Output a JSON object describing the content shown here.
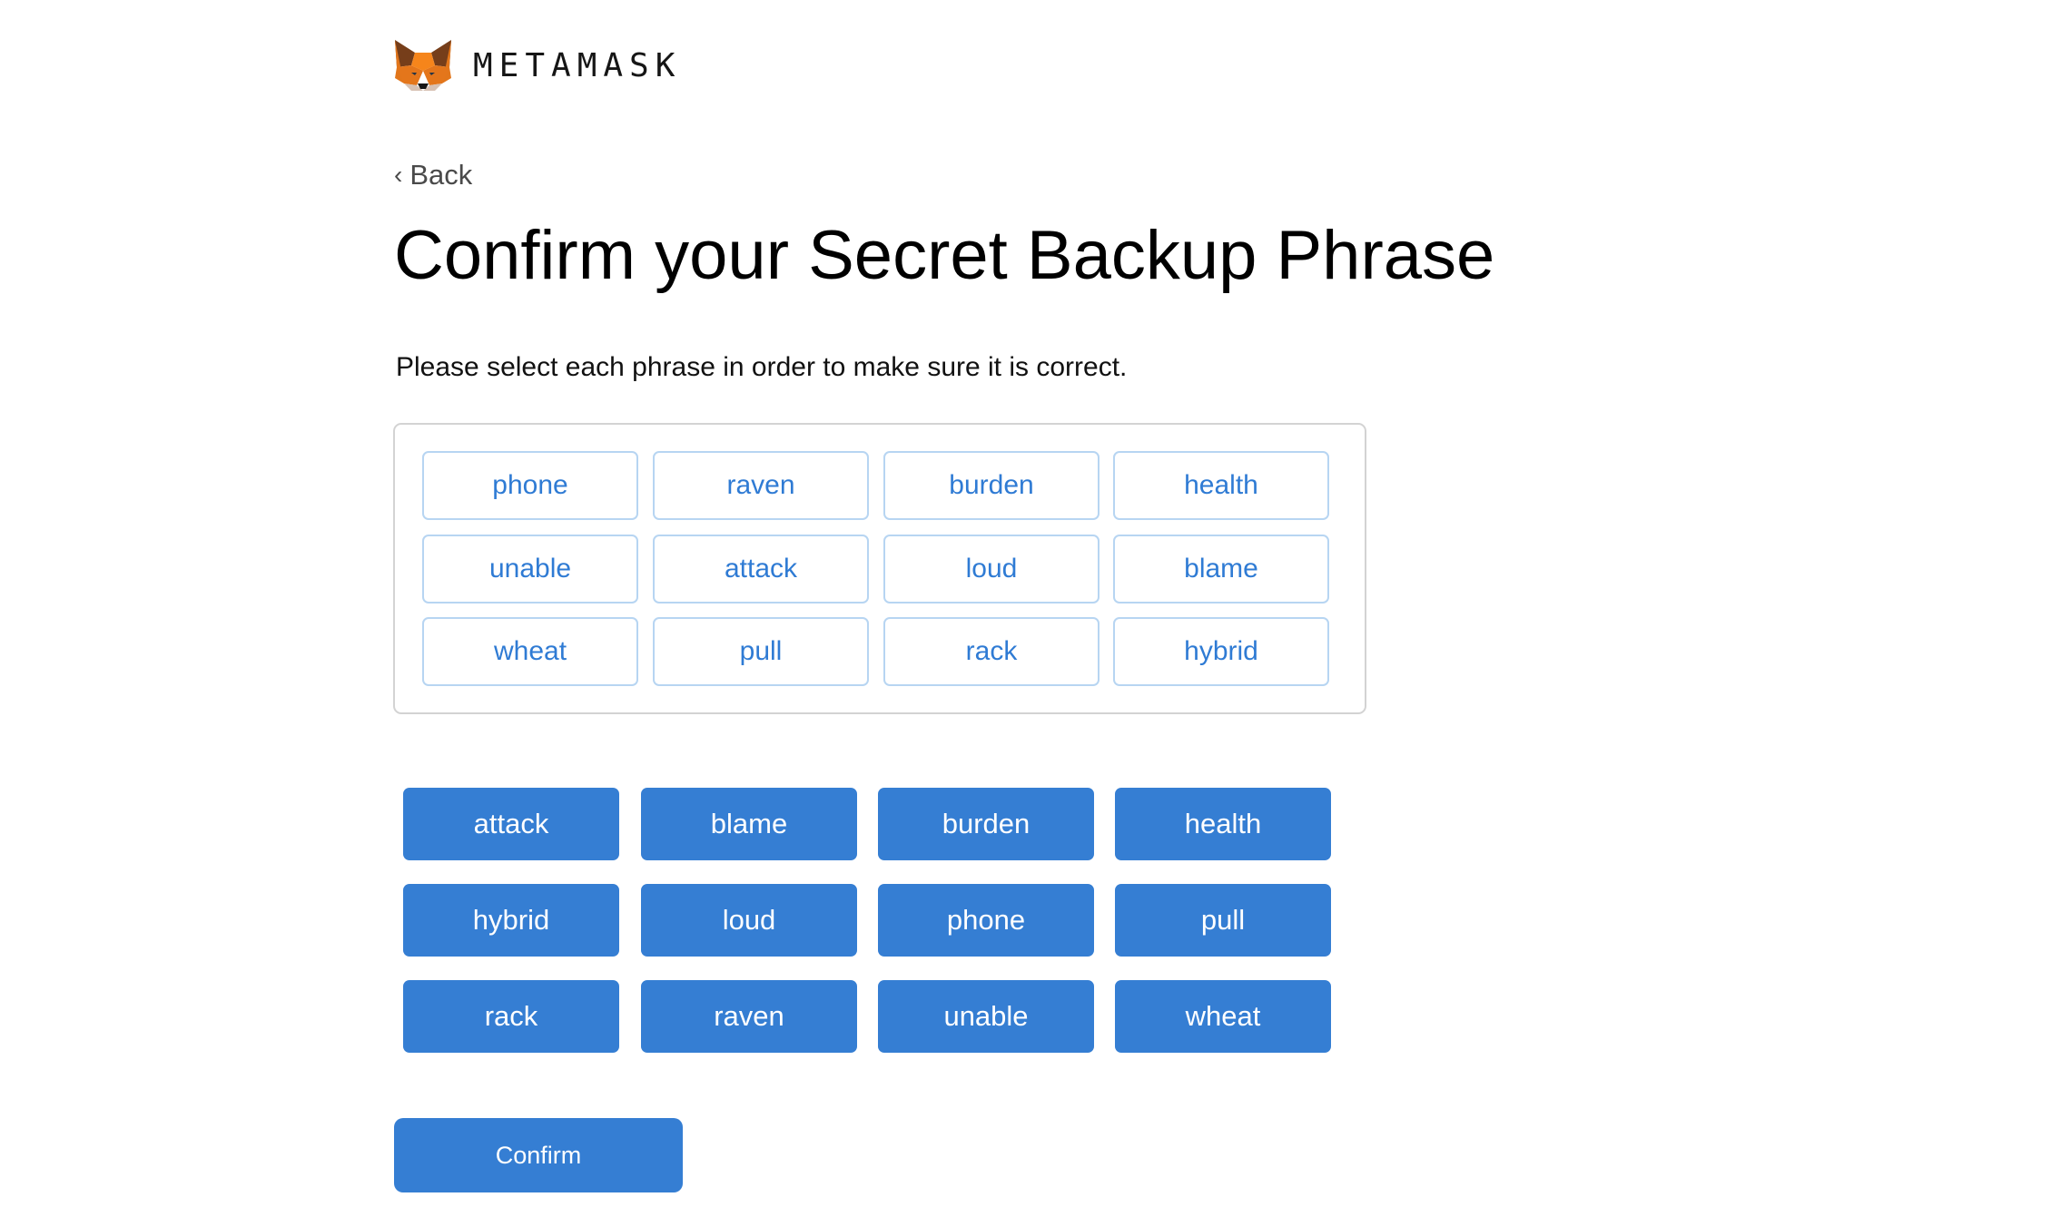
{
  "header": {
    "logo_icon": "metamask-fox-icon",
    "brand": "METAMASK"
  },
  "nav": {
    "back_label": "Back",
    "back_icon": "chevron-left-icon"
  },
  "page": {
    "title": "Confirm your Secret Backup Phrase",
    "instruction": "Please select each phrase in order to make sure it is correct."
  },
  "selected_words": [
    "phone",
    "raven",
    "burden",
    "health",
    "unable",
    "attack",
    "loud",
    "blame",
    "wheat",
    "pull",
    "rack",
    "hybrid"
  ],
  "available_words": [
    "attack",
    "blame",
    "burden",
    "health",
    "hybrid",
    "loud",
    "phone",
    "pull",
    "rack",
    "raven",
    "unable",
    "wheat"
  ],
  "actions": {
    "confirm_label": "Confirm"
  },
  "colors": {
    "accent": "#357ed3",
    "chip_text": "#2f7bd4",
    "chip_border": "#b7d5f2"
  }
}
